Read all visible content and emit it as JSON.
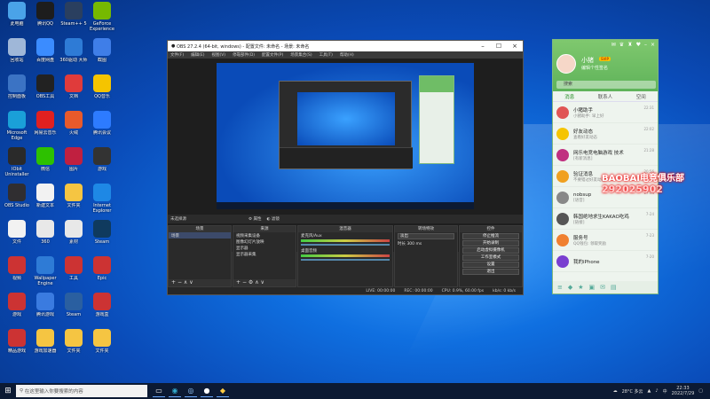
{
  "desktop": {
    "icons": [
      {
        "label": "此电脑",
        "icon": "computer-icon",
        "color": "#4aa3e8"
      },
      {
        "label": "腾讯QQ",
        "icon": "qq-penguin-icon",
        "color": "#1d1d1d"
      },
      {
        "label": "Steam++\n5",
        "icon": "steam-plus-icon",
        "color": "#2a3f5f"
      },
      {
        "label": "GeForce\nExperience",
        "icon": "nvidia-icon",
        "color": "#76b900"
      },
      {
        "label": "回收站",
        "icon": "recycle-bin-icon",
        "color": "#9fb7d8"
      },
      {
        "label": "百度网盘",
        "icon": "baidu-netdisk-icon",
        "color": "#3b8cff"
      },
      {
        "label": "360驱动\n大师",
        "icon": "driver-master-icon",
        "color": "#2e7bd6"
      },
      {
        "label": "截图",
        "icon": "screenshot-icon",
        "color": "#3f7ee8"
      },
      {
        "label": "控制面板",
        "icon": "control-panel-icon",
        "color": "#3b73c4"
      },
      {
        "label": "OBS工具",
        "icon": "obs-tool-icon",
        "color": "#222222"
      },
      {
        "label": "文档",
        "icon": "document-icon",
        "color": "#e03b3b"
      },
      {
        "label": "QQ音乐",
        "icon": "qq-music-icon",
        "color": "#f5c400"
      },
      {
        "label": "Microsoft\nEdge",
        "icon": "edge-icon",
        "color": "#1aa0d8"
      },
      {
        "label": "网易云音乐",
        "icon": "netease-music-icon",
        "color": "#e02020"
      },
      {
        "label": "火绒",
        "icon": "huorong-icon",
        "color": "#e85a2b"
      },
      {
        "label": "腾讯会议",
        "icon": "tencent-meeting-icon",
        "color": "#2d7bff"
      },
      {
        "label": "IObit\nUninstaller",
        "icon": "uninstaller-icon",
        "color": "#2a2a2a"
      },
      {
        "label": "微信",
        "icon": "wechat-icon",
        "color": "#2dc100"
      },
      {
        "label": "图片",
        "icon": "picture-icon",
        "color": "#c02040"
      },
      {
        "label": "游戏",
        "icon": "game-icon",
        "color": "#333333"
      },
      {
        "label": "OBS Studio",
        "icon": "obs-icon",
        "color": "#302e31"
      },
      {
        "label": "新建文本",
        "icon": "text-file-icon",
        "color": "#f2f2f2"
      },
      {
        "label": "文件夹",
        "icon": "folder-icon",
        "color": "#f5c542"
      },
      {
        "label": "Internet\nExplorer",
        "icon": "ie-icon",
        "color": "#1e88e5"
      },
      {
        "label": "文件",
        "icon": "file-icon",
        "color": "#f2f2f2"
      },
      {
        "label": "360",
        "icon": "security-icon",
        "color": "#e8e8e8"
      },
      {
        "label": "素材",
        "icon": "material-icon",
        "color": "#e8e8e8"
      },
      {
        "label": "Steam",
        "icon": "steam-icon",
        "color": "#0f3a5e"
      },
      {
        "label": "视频",
        "icon": "video-icon",
        "color": "#cc3333"
      },
      {
        "label": "Wallpaper\nEngine",
        "icon": "wallpaper-icon",
        "color": "#2e7bd6"
      },
      {
        "label": "工具",
        "icon": "tool-icon",
        "color": "#cc3333"
      },
      {
        "label": "Epic",
        "icon": "epic-icon",
        "color": "#cc3333"
      },
      {
        "label": "游戏",
        "icon": "game-red-icon",
        "color": "#cc3333"
      },
      {
        "label": "腾讯游戏",
        "icon": "tencent-game-icon",
        "color": "#3a7be0"
      },
      {
        "label": "Steam",
        "icon": "steam-icon",
        "color": "#2a5fa0"
      },
      {
        "label": "游戏盒",
        "icon": "game-box-icon",
        "color": "#cc3333"
      },
      {
        "label": "精品游戏",
        "icon": "game-icon",
        "color": "#cc3333"
      },
      {
        "label": "游戏加速器",
        "icon": "accelerator-icon",
        "color": "#f5c542"
      },
      {
        "label": "文件夹",
        "icon": "folder-icon",
        "color": "#f5c542"
      },
      {
        "label": "文件夹",
        "icon": "folder-icon",
        "color": "#f5c542"
      }
    ]
  },
  "obs": {
    "title": "OBS 27.2.4 (64-bit, windows) - 配置文件: 未命名 - 场景: 未命名",
    "menu": [
      "文件(F)",
      "编辑(E)",
      "视图(V)",
      "停靠部件(D)",
      "配置文件(P)",
      "场景集合(S)",
      "工具(T)",
      "帮助(H)"
    ],
    "no_source": "未选择源",
    "props_btn": "属性",
    "filters_btn": "滤镜",
    "docks": {
      "scenes": {
        "title": "场景",
        "items": [
          "场景"
        ]
      },
      "sources": {
        "title": "来源",
        "items": [
          "视频采集设备",
          "图像幻灯片放映",
          "显示器",
          "显示器采集"
        ]
      },
      "mixer": {
        "title": "混音器",
        "tracks": [
          {
            "name": "麦克风/Aux",
            "db": "0.0 dB"
          },
          {
            "name": "桌面音频",
            "db": "0.0 dB"
          }
        ]
      },
      "transitions": {
        "title": "转场特效",
        "type": "淡出",
        "duration_label": "时长",
        "duration": "300 ms"
      },
      "controls": {
        "title": "控件",
        "buttons": [
          "停止推流",
          "开始录制",
          "启动虚拟摄像机",
          "工作室模式",
          "设置",
          "退出"
        ]
      }
    },
    "status": {
      "live": "LIVE: 00:00:00",
      "rec": "REC: 00:00:00",
      "cpu": "CPU: 0.9%, 60.00 fps",
      "kbps": "kb/s: 0 kb/s"
    }
  },
  "qq": {
    "header_icons": [
      "mail-icon",
      "skin-icon",
      "shirt-icon",
      "heart-icon",
      "minimize-icon",
      "close-icon"
    ],
    "nickname": "小猪",
    "vip": "SVIP",
    "signature": "编辑个性签名",
    "search_placeholder": "搜索",
    "tabs": [
      "消息",
      "联系人",
      "空间"
    ],
    "chats": [
      {
        "name": "小猪助手",
        "preview": "小猪助手: 早上好",
        "time": "22:31",
        "color": "#e05555"
      },
      {
        "name": "好友动态",
        "preview": "查看好友动态",
        "time": "22:02",
        "color": "#f5c400"
      },
      {
        "name": "网乐电竞电脑游戏 技术",
        "preview": "[有新消息]",
        "time": "21:28",
        "color": "#c03080"
      },
      {
        "name": "验证消息",
        "preview": "不要错过好友动态",
        "time": "20:56",
        "color": "#f0a020"
      },
      {
        "name": "nobsup",
        "preview": "[语音]",
        "time": "17:04",
        "color": "#888888"
      },
      {
        "name": "韩国绝地求生KAKAO吃鸡",
        "preview": "[链接]",
        "time": "7-24",
        "color": "#555555"
      },
      {
        "name": "服务号",
        "preview": "QQ钱包: 领取奖励",
        "time": "7-23",
        "color": "#f08030"
      },
      {
        "name": "我的iPhone",
        "preview": "",
        "time": "7-20",
        "color": "#7a3fd0"
      }
    ]
  },
  "overlay": {
    "line1": "BAOBAI电竞俱乐部",
    "line2": "292025902"
  },
  "taskbar": {
    "search_placeholder": "在这里输入你要搜索的内容",
    "weather": "28°C 多云",
    "ime": "中",
    "time": "22:33",
    "date": "2022/7/29"
  }
}
